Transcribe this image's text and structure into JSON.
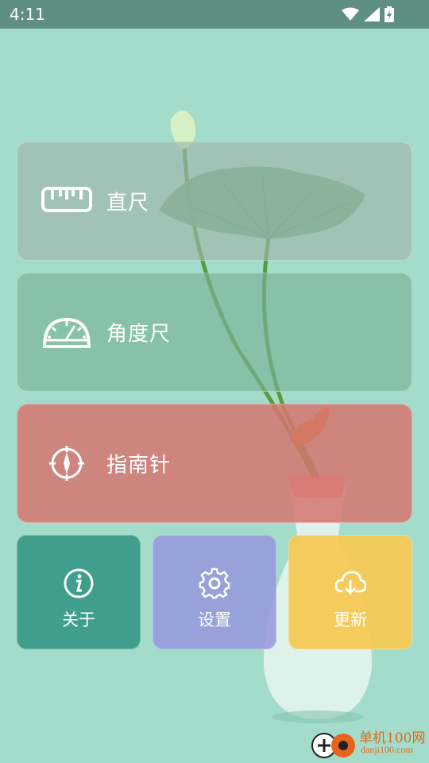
{
  "status_bar": {
    "time": "4:11"
  },
  "menu": {
    "ruler": {
      "label": "直尺",
      "icon": "ruler-icon",
      "color": "#a0b4aa"
    },
    "protractor": {
      "label": "角度尺",
      "icon": "protractor-icon",
      "color": "#78b296"
    },
    "compass": {
      "label": "指南针",
      "icon": "compass-icon",
      "color": "#d67670"
    }
  },
  "tiles": {
    "about": {
      "label": "关于",
      "icon": "info-icon",
      "color": "#3f9e8c"
    },
    "settings": {
      "label": "设置",
      "icon": "gear-icon",
      "color": "#9696dc"
    },
    "update": {
      "label": "更新",
      "icon": "cloud-download-icon",
      "color": "#f6c850"
    }
  },
  "watermark": {
    "title": "单机100网",
    "url": "danji100.com"
  }
}
